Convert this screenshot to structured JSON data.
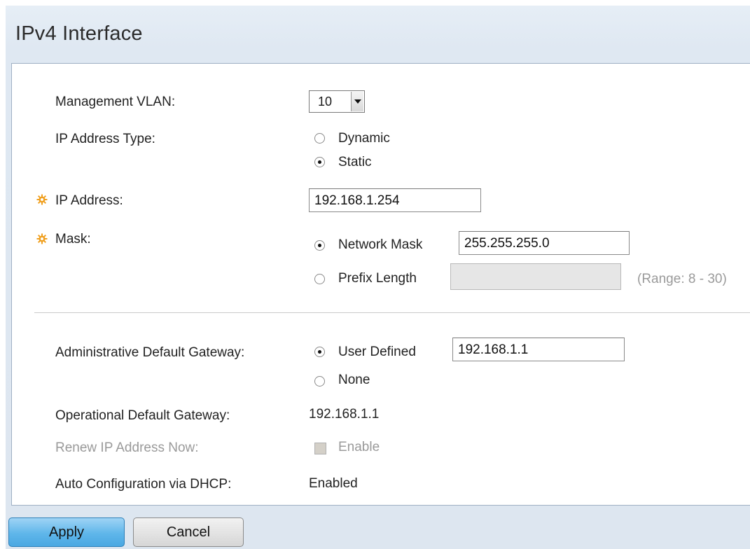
{
  "page": {
    "title": "IPv4 Interface"
  },
  "form": {
    "management_vlan": {
      "label": "Management VLAN:",
      "value": "10"
    },
    "ip_address_type": {
      "label": "IP Address Type:",
      "options": [
        "Dynamic",
        "Static"
      ],
      "selected": "Static"
    },
    "ip_address": {
      "label": "IP Address:",
      "value": "192.168.1.254"
    },
    "mask": {
      "label": "Mask:",
      "network_mask_label": "Network Mask",
      "network_mask_value": "255.255.255.0",
      "prefix_length_label": "Prefix Length",
      "prefix_length_value": "",
      "prefix_range": "(Range: 8 - 30)",
      "selected": "Network Mask"
    },
    "admin_default_gateway": {
      "label": "Administrative Default Gateway:",
      "user_defined_label": "User Defined",
      "user_defined_value": "192.168.1.1",
      "none_label": "None",
      "selected": "User Defined"
    },
    "operational_default_gateway": {
      "label": "Operational Default Gateway:",
      "value": "192.168.1.1"
    },
    "renew_ip": {
      "label": "Renew IP Address Now:",
      "checkbox_label": "Enable",
      "disabled": true
    },
    "auto_config": {
      "label": "Auto Configuration via DHCP:",
      "value": "Enabled"
    }
  },
  "buttons": {
    "apply": "Apply",
    "cancel": "Cancel"
  },
  "icons": {
    "required": "gear-asterisk-icon"
  },
  "colors": {
    "required_icon": "#f0a020",
    "apply_button": "#5fb6ea",
    "panel_border": "#9fb0c4"
  }
}
